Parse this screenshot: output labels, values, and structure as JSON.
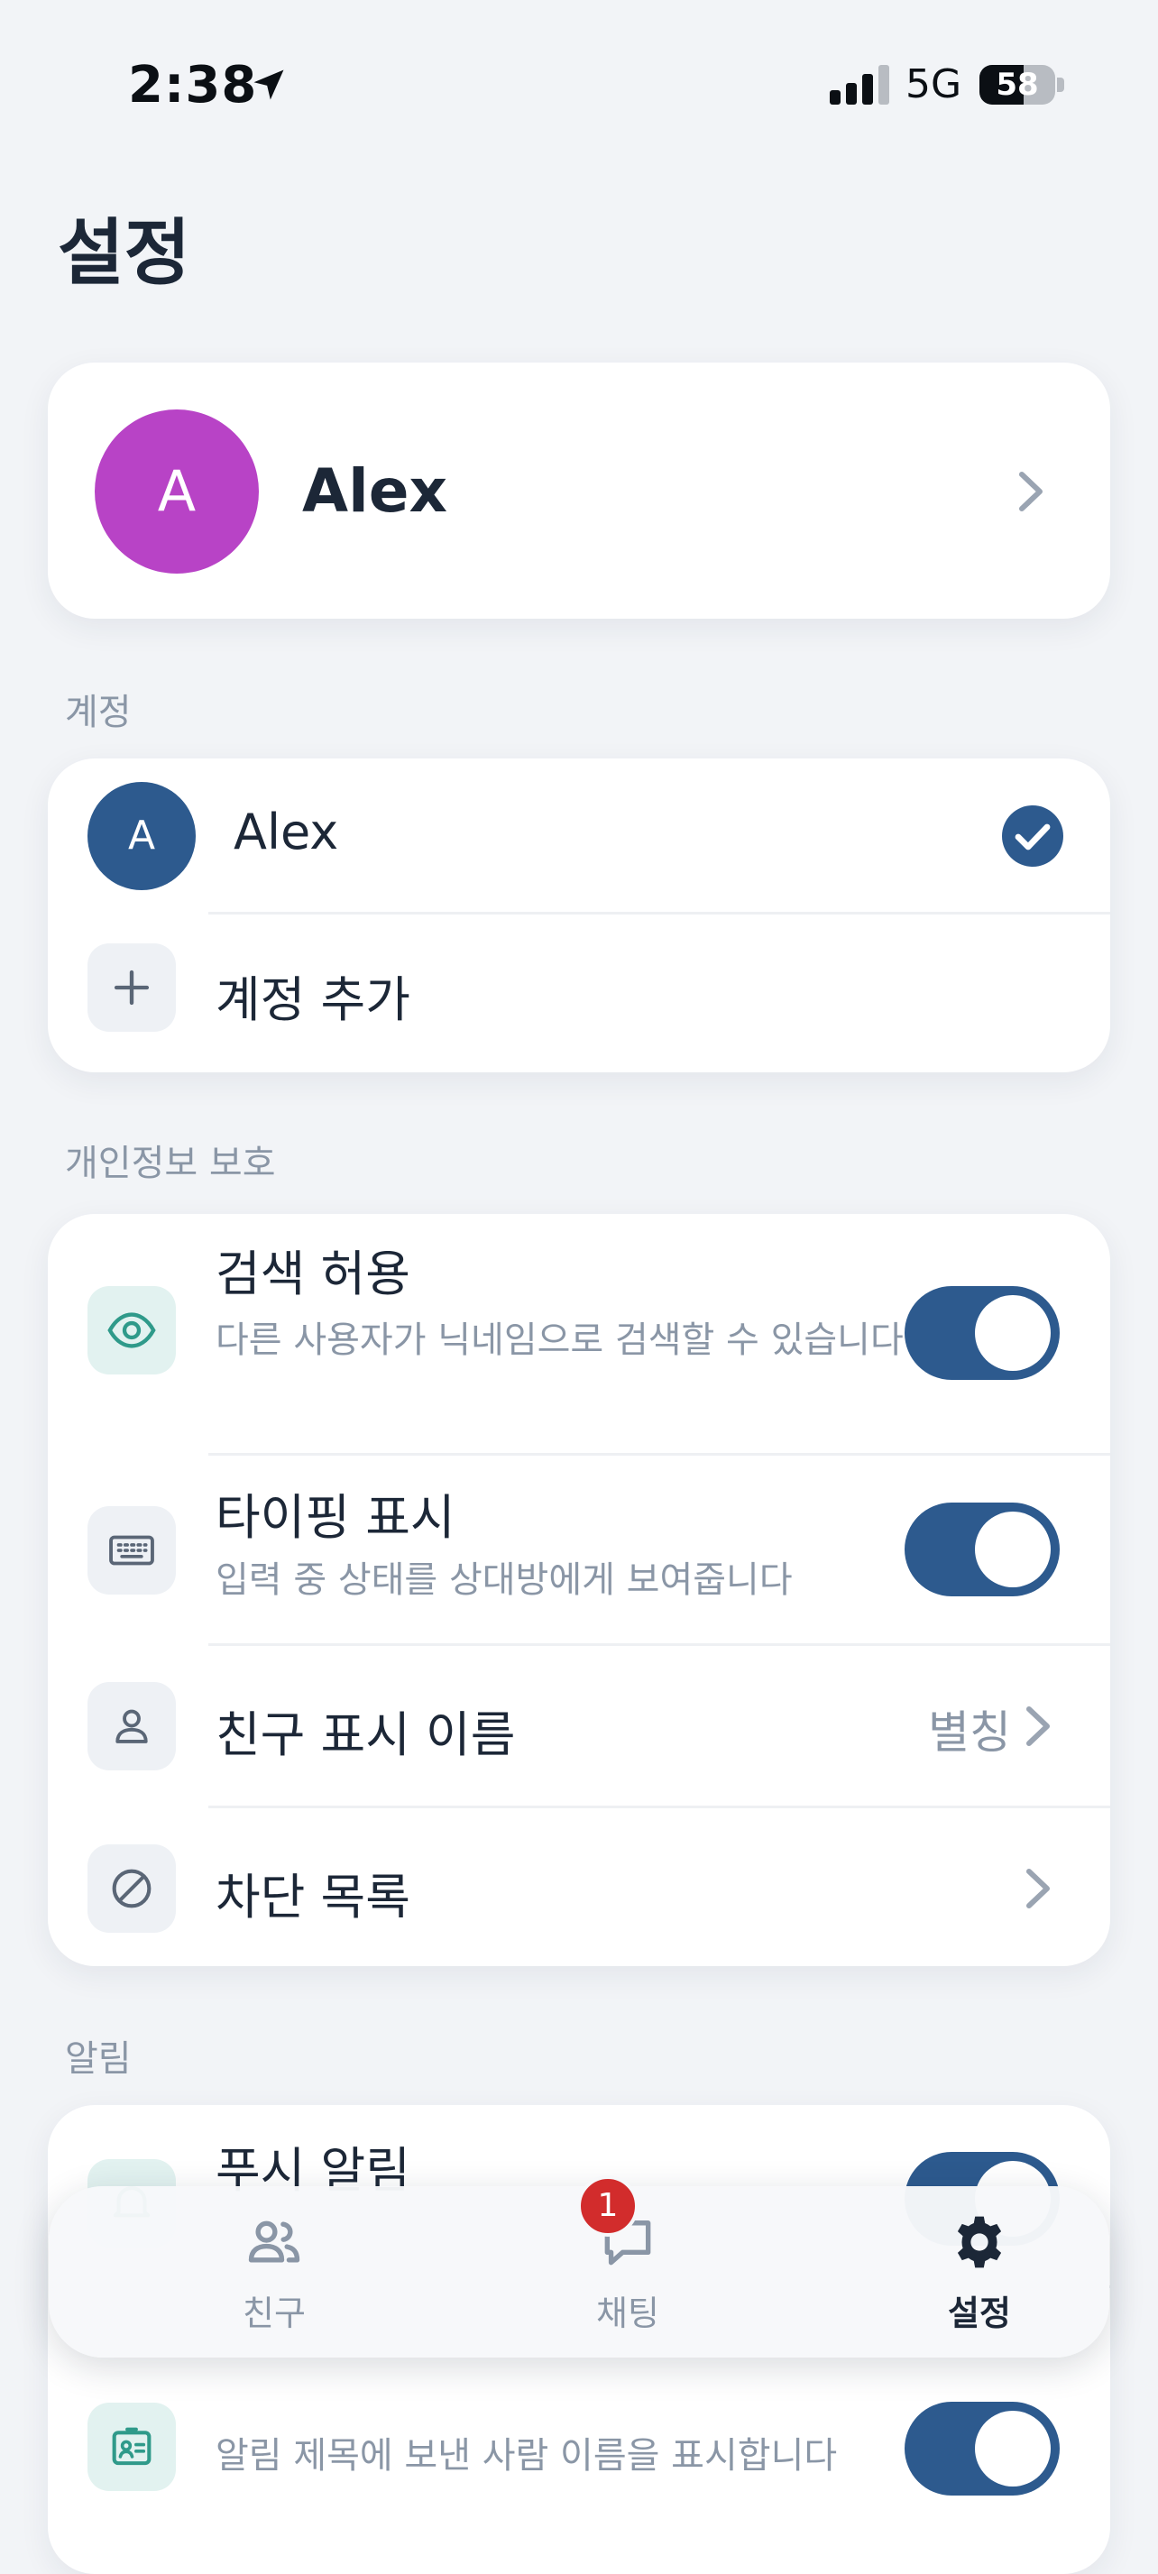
{
  "status_bar": {
    "time": "2:38",
    "network": "5G",
    "battery": "58",
    "battery_level": 0.58
  },
  "page": {
    "title": "설정"
  },
  "profile": {
    "avatar_letter": "A",
    "name": "Alex",
    "avatar_color": "#b843c6"
  },
  "account_section": {
    "label": "계정",
    "current": {
      "avatar_letter": "A",
      "name": "Alex",
      "avatar_color": "#2d5a8e"
    },
    "add_label": "계정 추가"
  },
  "privacy_section": {
    "label": "개인정보 보호",
    "items": [
      {
        "title": "검색 허용",
        "subtitle": "다른 사용자가 닉네임으로 검색할 수 있습니다",
        "toggle": true,
        "icon": "eye-icon"
      },
      {
        "title": "타이핑 표시",
        "subtitle": "입력 중 상태를 상대방에게 보여줍니다",
        "toggle": true,
        "icon": "keyboard-icon"
      },
      {
        "title": "친구 표시 이름",
        "value": "별칭",
        "icon": "person-icon"
      },
      {
        "title": "차단 목록",
        "icon": "block-icon"
      }
    ]
  },
  "notification_section": {
    "label": "알림",
    "items": [
      {
        "title": "푸시 알림",
        "toggle": true,
        "icon": "bell-icon"
      },
      {
        "subtitle": "알림 제목에 보낸 사람 이름을 표시합니다",
        "toggle": true,
        "icon": "contact-card-icon"
      }
    ]
  },
  "tab_bar": {
    "tabs": [
      {
        "label": "친구",
        "icon": "people-icon",
        "active": false
      },
      {
        "label": "채팅",
        "icon": "chat-icon",
        "active": false,
        "badge": "1"
      },
      {
        "label": "설정",
        "icon": "gear-icon",
        "active": true
      }
    ]
  },
  "colors": {
    "accent": "#2d5a8e",
    "teal_icon": "#2f9a8a",
    "badge": "#d22c2c"
  }
}
